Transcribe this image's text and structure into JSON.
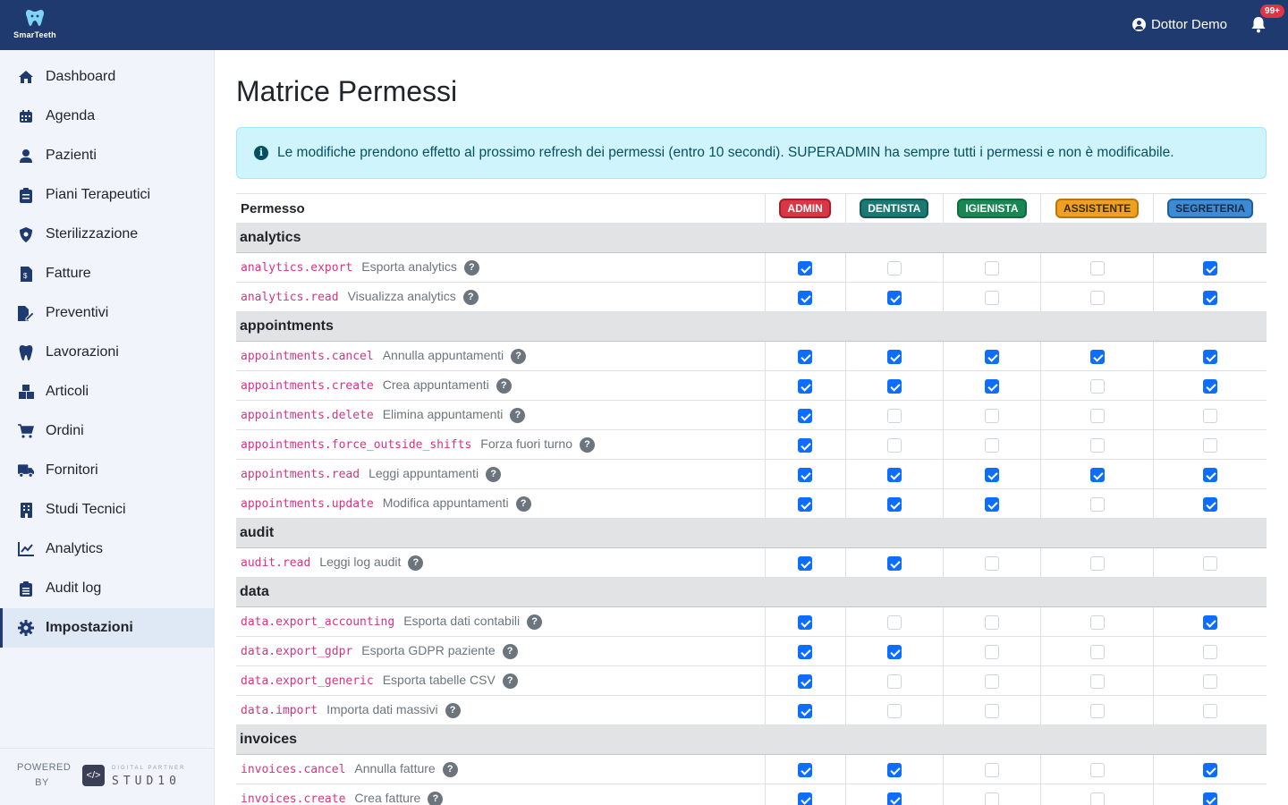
{
  "app": {
    "brand": "SmarTeeth"
  },
  "header": {
    "user_name": "Dottor Demo",
    "notif_count": "99+"
  },
  "sidebar": {
    "items": [
      {
        "label": "Dashboard",
        "icon": "home-icon"
      },
      {
        "label": "Agenda",
        "icon": "calendar-icon"
      },
      {
        "label": "Pazienti",
        "icon": "user-icon"
      },
      {
        "label": "Piani Terapeutici",
        "icon": "clipboard-icon"
      },
      {
        "label": "Sterilizzazione",
        "icon": "shield-virus-icon"
      },
      {
        "label": "Fatture",
        "icon": "invoice-icon"
      },
      {
        "label": "Preventivi",
        "icon": "file-pen-icon"
      },
      {
        "label": "Lavorazioni",
        "icon": "tooth-icon"
      },
      {
        "label": "Articoli",
        "icon": "boxes-icon"
      },
      {
        "label": "Ordini",
        "icon": "cart-icon"
      },
      {
        "label": "Fornitori",
        "icon": "truck-icon"
      },
      {
        "label": "Studi Tecnici",
        "icon": "building-icon"
      },
      {
        "label": "Analytics",
        "icon": "chart-line-icon"
      },
      {
        "label": "Audit log",
        "icon": "clipboard-list-icon"
      },
      {
        "label": "Impostazioni",
        "icon": "gear-icon",
        "active": true
      }
    ],
    "powered": "POWERED BY",
    "partner_tag": "DIGITAL PARTNER",
    "partner_name": "STUD10"
  },
  "page": {
    "title": "Matrice Permessi",
    "alert": "Le modifiche prendono effetto al prossimo refresh dei permessi (entro 10 secondi). SUPERADMIN ha sempre tutti i permessi e non è modificabile."
  },
  "table": {
    "perm_header": "Permesso",
    "roles": [
      {
        "label": "ADMIN",
        "bg": "#dc3545",
        "border": "#a71d2a",
        "color": "#ffffff"
      },
      {
        "label": "DENTISTA",
        "bg": "#1a7a73",
        "border": "#0f5953",
        "color": "#ffffff"
      },
      {
        "label": "IGIENISTA",
        "bg": "#198754",
        "border": "#0f6b40",
        "color": "#ffffff"
      },
      {
        "label": "ASSISTENTE",
        "bg": "#f0a020",
        "border": "#b8760c",
        "color": "#3a2a00"
      },
      {
        "label": "SEGRETERIA",
        "bg": "#3d8bd4",
        "border": "#1f5fa0",
        "color": "#1a2a4a"
      }
    ],
    "groups": [
      {
        "name": "analytics",
        "rows": [
          {
            "code": "analytics.export",
            "desc": "Esporta analytics",
            "values": [
              true,
              false,
              false,
              false,
              true
            ]
          },
          {
            "code": "analytics.read",
            "desc": "Visualizza analytics",
            "values": [
              true,
              true,
              false,
              false,
              true
            ]
          }
        ]
      },
      {
        "name": "appointments",
        "rows": [
          {
            "code": "appointments.cancel",
            "desc": "Annulla appuntamenti",
            "values": [
              true,
              true,
              true,
              true,
              true
            ]
          },
          {
            "code": "appointments.create",
            "desc": "Crea appuntamenti",
            "values": [
              true,
              true,
              true,
              false,
              true
            ]
          },
          {
            "code": "appointments.delete",
            "desc": "Elimina appuntamenti",
            "values": [
              true,
              false,
              false,
              false,
              false
            ]
          },
          {
            "code": "appointments.force_outside_shifts",
            "desc": "Forza fuori turno",
            "values": [
              true,
              false,
              false,
              false,
              false
            ]
          },
          {
            "code": "appointments.read",
            "desc": "Leggi appuntamenti",
            "values": [
              true,
              true,
              true,
              true,
              true
            ]
          },
          {
            "code": "appointments.update",
            "desc": "Modifica appuntamenti",
            "values": [
              true,
              true,
              true,
              false,
              true
            ]
          }
        ]
      },
      {
        "name": "audit",
        "rows": [
          {
            "code": "audit.read",
            "desc": "Leggi log audit",
            "values": [
              true,
              true,
              false,
              false,
              false
            ]
          }
        ]
      },
      {
        "name": "data",
        "rows": [
          {
            "code": "data.export_accounting",
            "desc": "Esporta dati contabili",
            "values": [
              true,
              false,
              false,
              false,
              true
            ]
          },
          {
            "code": "data.export_gdpr",
            "desc": "Esporta GDPR paziente",
            "values": [
              true,
              true,
              false,
              false,
              false
            ]
          },
          {
            "code": "data.export_generic",
            "desc": "Esporta tabelle CSV",
            "values": [
              true,
              false,
              false,
              false,
              false
            ]
          },
          {
            "code": "data.import",
            "desc": "Importa dati massivi",
            "values": [
              true,
              false,
              false,
              false,
              false
            ]
          }
        ]
      },
      {
        "name": "invoices",
        "rows": [
          {
            "code": "invoices.cancel",
            "desc": "Annulla fatture",
            "values": [
              true,
              true,
              false,
              false,
              true
            ]
          },
          {
            "code": "invoices.create",
            "desc": "Crea fatture",
            "values": [
              true,
              true,
              false,
              false,
              true
            ]
          }
        ]
      }
    ]
  }
}
